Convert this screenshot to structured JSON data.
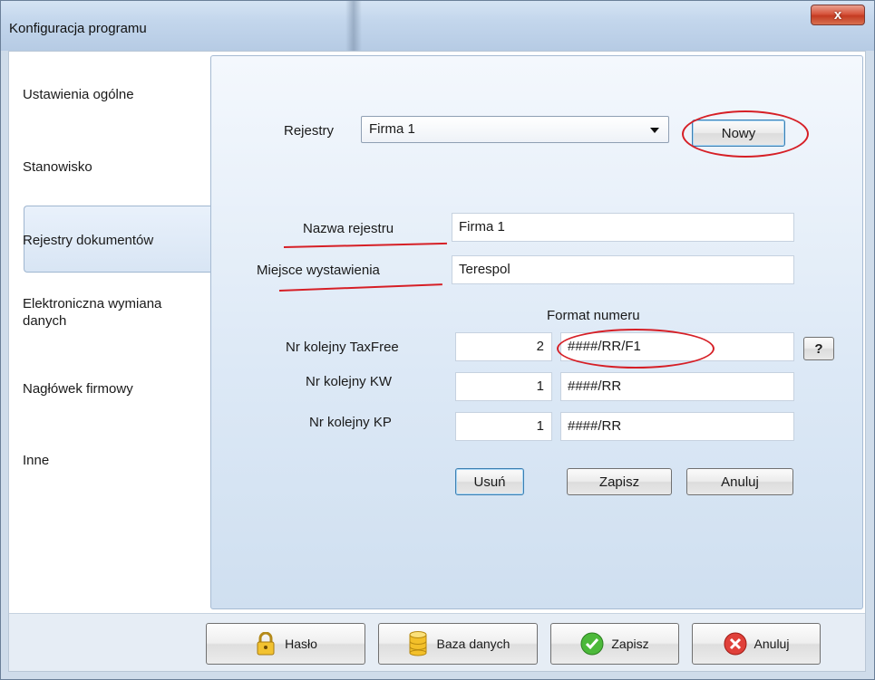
{
  "window": {
    "title": "Konfiguracja programu",
    "close_label": "x"
  },
  "sidebar": {
    "items": [
      {
        "label": "Ustawienia ogólne"
      },
      {
        "label": "Stanowisko"
      },
      {
        "label": "Rejestry dokumentów",
        "active": true
      },
      {
        "label": "Elektroniczna wymiana danych"
      },
      {
        "label": "Nagłówek firmowy"
      },
      {
        "label": "Inne"
      }
    ]
  },
  "registers": {
    "label": "Rejestry",
    "selected": "Firma 1",
    "new_button": "Nowy"
  },
  "form": {
    "name_label": "Nazwa rejestru",
    "name_value": "Firma 1",
    "place_label": "Miejsce wystawienia",
    "place_value": "Terespol",
    "format_header": "Format numeru",
    "rows": [
      {
        "label": "Nr kolejny TaxFree",
        "number": "2",
        "format": "####/RR/F1"
      },
      {
        "label": "Nr kolejny KW",
        "number": "1",
        "format": "####/RR"
      },
      {
        "label": "Nr kolejny KP",
        "number": "1",
        "format": "####/RR"
      }
    ],
    "help_button": "?",
    "delete_button": "Usuń",
    "save_button": "Zapisz",
    "cancel_button": "Anuluj"
  },
  "footer": {
    "password_button": "Hasło",
    "database_button": "Baza danych",
    "save_button": "Zapisz",
    "cancel_button": "Anuluj"
  },
  "colors": {
    "annotation": "#d61f26",
    "accent": "#3c7fb1"
  }
}
